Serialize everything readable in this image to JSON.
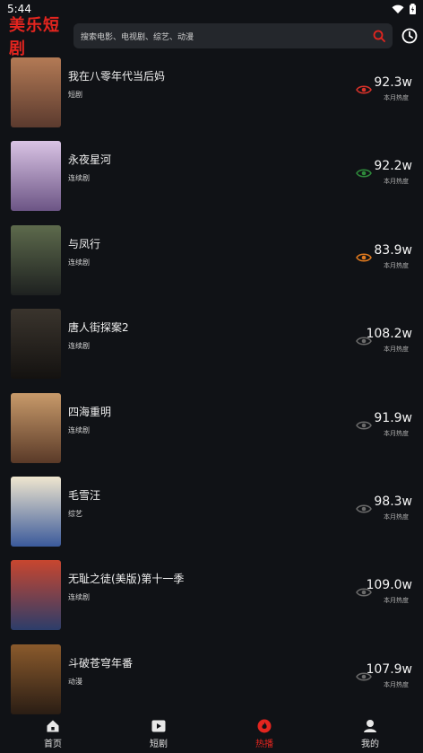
{
  "status_bar": {
    "time": "5:44"
  },
  "header": {
    "logo_text": "美乐短剧",
    "search_placeholder": "搜索电影、电视剧、综艺、动漫",
    "accent_color": "#e3251f"
  },
  "list": [
    {
      "title": "我在八零年代当后妈",
      "tag": "短剧",
      "heat": "92.3w",
      "heat_label": "本月热度",
      "eye_color": "#d8322a",
      "poster_colors": [
        "#b37a55",
        "#5b3a2e"
      ]
    },
    {
      "title": "永夜星河",
      "tag": "连续剧",
      "heat": "92.2w",
      "heat_label": "本月热度",
      "eye_color": "#2e8b3b",
      "poster_colors": [
        "#d9c3e4",
        "#6c5585"
      ]
    },
    {
      "title": "与凤行",
      "tag": "连续剧",
      "heat": "83.9w",
      "heat_label": "本月热度",
      "eye_color": "#e07a1f",
      "poster_colors": [
        "#5d6a4c",
        "#1e2120"
      ]
    },
    {
      "title": "唐人街探案2",
      "tag": "连续剧",
      "heat": "108.2w",
      "heat_label": "本月热度",
      "eye_color": "#6a6a6a",
      "poster_colors": [
        "#3a342d",
        "#141210"
      ]
    },
    {
      "title": "四海重明",
      "tag": "连续剧",
      "heat": "91.9w",
      "heat_label": "本月热度",
      "eye_color": "#6a6a6a",
      "poster_colors": [
        "#c89a6a",
        "#5a3a28"
      ]
    },
    {
      "title": "毛雪汪",
      "tag": "综艺",
      "heat": "98.3w",
      "heat_label": "本月热度",
      "eye_color": "#6a6a6a",
      "poster_colors": [
        "#efe6cf",
        "#3b5a9b"
      ]
    },
    {
      "title": "无耻之徒(美版)第十一季",
      "tag": "连续剧",
      "heat": "109.0w",
      "heat_label": "本月热度",
      "eye_color": "#6a6a6a",
      "poster_colors": [
        "#c8462f",
        "#2c3d6a"
      ]
    },
    {
      "title": "斗破苍穹年番",
      "tag": "动漫",
      "heat": "107.9w",
      "heat_label": "本月热度",
      "eye_color": "#6a6a6a",
      "poster_colors": [
        "#8a5a2c",
        "#2a1d14"
      ]
    }
  ],
  "tabbar": {
    "home": "首页",
    "drama": "短剧",
    "hot": "热播",
    "mine": "我的",
    "active": "hot"
  }
}
